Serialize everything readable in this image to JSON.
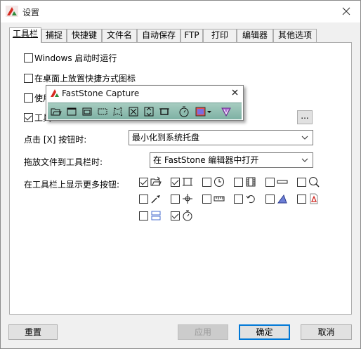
{
  "window": {
    "title": "设置"
  },
  "tabs": [
    {
      "label": "工具栏",
      "active": true
    },
    {
      "label": "捕捉"
    },
    {
      "label": "快捷键"
    },
    {
      "label": "文件名"
    },
    {
      "label": "自动保存"
    },
    {
      "label": "FTP"
    },
    {
      "label": "打印"
    },
    {
      "label": "编辑器"
    },
    {
      "label": "其他选项"
    }
  ],
  "options": [
    {
      "label": "Windows 启动时运行",
      "checked": false
    },
    {
      "label": "在桌面上放置快捷方式图标",
      "checked": false
    },
    {
      "label": "使用",
      "checked": false
    },
    {
      "label": "工具",
      "checked": true
    }
  ],
  "ellipsis_label": "...",
  "click_x": {
    "label": "点击 [X] 按钮时:",
    "value": "最小化到系统托盘"
  },
  "drag_file": {
    "label": "拖放文件到工具栏时:",
    "value": "在 FastStone 编辑器中打开"
  },
  "more_buttons": {
    "label": "在工具栏上显示更多按钮:",
    "items": [
      {
        "icon": "open-folder-icon",
        "checked": true
      },
      {
        "icon": "capture-region-icon",
        "checked": true
      },
      {
        "icon": "timer-clock-icon",
        "checked": false
      },
      {
        "icon": "film-strip-icon",
        "checked": false
      },
      {
        "icon": "horizontal-bar-icon",
        "checked": false
      },
      {
        "icon": "magnifier-icon",
        "checked": false
      },
      {
        "icon": "color-picker-icon",
        "checked": false
      },
      {
        "icon": "crosshair-icon",
        "checked": false
      },
      {
        "icon": "ruler-icon",
        "checked": false
      },
      {
        "icon": "undo-arrow-icon",
        "checked": false
      },
      {
        "icon": "screen-draw-icon",
        "checked": false
      },
      {
        "icon": "pdf-icon",
        "checked": false
      },
      {
        "icon": "split-panel-icon",
        "checked": false
      },
      {
        "icon": "stopwatch-icon",
        "checked": true
      }
    ]
  },
  "floating_toolbar": {
    "title": "FastStone Capture",
    "buttons": [
      "open-folder-icon",
      "active-window-icon",
      "window-object-icon",
      "rectangle-region-icon",
      "freehand-region-icon",
      "fullscreen-icon",
      "scrolling-window-icon",
      "fixed-region-icon",
      "delay-timer-icon",
      "output-color-icon",
      "settings-menu-icon"
    ]
  },
  "buttons": {
    "reset": "重置",
    "apply": "应用",
    "ok": "确定",
    "cancel": "取消"
  },
  "colors": {
    "toolbar_strip": "#8fbfb2",
    "accent": "#0078d7",
    "pdf": "#d0241e"
  }
}
